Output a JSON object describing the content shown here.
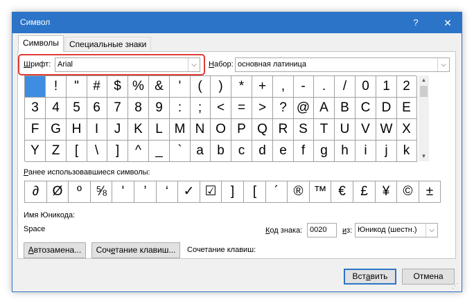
{
  "window": {
    "title": "Символ",
    "help_label": "?",
    "close_label": "✕"
  },
  "tabs": [
    {
      "label": "Символы",
      "active": true
    },
    {
      "label": "Специальные знаки",
      "active": false
    }
  ],
  "font_field": {
    "label_prefix": "Ш",
    "label_rest": "рифт:",
    "value": "Arial",
    "highlight_color": "#e03b36"
  },
  "subset_field": {
    "label_prefix": "Н",
    "label_rest": "абор:",
    "value": "основная латиница"
  },
  "symbol_grid": {
    "selected_index": 0,
    "rows": [
      [
        " ",
        "!",
        "\"",
        "#",
        "$",
        "%",
        "&",
        "'",
        "(",
        ")",
        "*",
        "+",
        ",",
        "-",
        ".",
        "/",
        "0",
        "1",
        "2"
      ],
      [
        "3",
        "4",
        "5",
        "6",
        "7",
        "8",
        "9",
        ":",
        ";",
        "<",
        "=",
        ">",
        "?",
        "@",
        "A",
        "B",
        "C",
        "D",
        "E"
      ],
      [
        "F",
        "G",
        "H",
        "I",
        "J",
        "K",
        "L",
        "M",
        "N",
        "O",
        "P",
        "Q",
        "R",
        "S",
        "T",
        "U",
        "V",
        "W",
        "X"
      ],
      [
        "Y",
        "Z",
        "[",
        "\\",
        "]",
        "^",
        "_",
        "`",
        "a",
        "b",
        "c",
        "d",
        "e",
        "f",
        "g",
        "h",
        "i",
        "j",
        "k"
      ]
    ],
    "selection_color": "#3f8de0"
  },
  "scrollbar": {
    "up_icon": "▲",
    "down_icon": "▼"
  },
  "recent": {
    "label_prefix": "Р",
    "label_rest": "анее использовавшиеся символы:",
    "symbols": [
      "∂",
      "Ø",
      "º",
      "⅝",
      "'",
      "’",
      "‘",
      "✓",
      "☑",
      "]",
      "[",
      "´",
      "®",
      "™",
      "€",
      "£",
      "¥",
      "©",
      "±"
    ]
  },
  "unicode_name": {
    "label": "Имя Юникода:",
    "value": "Space"
  },
  "char_code": {
    "label_prefix": "К",
    "label_rest": "од знака:",
    "value": "0020"
  },
  "from_field": {
    "label_prefix": "и",
    "label_rest": "з:",
    "value": "Юникод (шестн.)"
  },
  "buttons": {
    "autocorrect_prefix": "А",
    "autocorrect_rest": "втозамена...",
    "shortcut_key_prefix": "Соч",
    "shortcut_key_mid": "е",
    "shortcut_key_rest": "тание клавиш...",
    "shortcut_text": "Сочетание клавиш:",
    "insert_prefix": "Вст",
    "insert_mid": "а",
    "insert_rest": "вить",
    "cancel": "Отмена"
  }
}
